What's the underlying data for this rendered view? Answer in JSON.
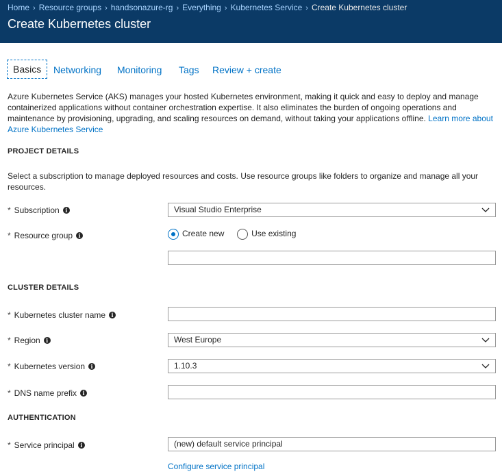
{
  "breadcrumb": [
    "Home",
    "Resource groups",
    "handsonazure-rg",
    "Everything",
    "Kubernetes Service"
  ],
  "breadcrumb_current": "Create Kubernetes cluster",
  "title": "Create Kubernetes cluster",
  "tabs": [
    "Basics",
    "Networking",
    "Monitoring",
    "Tags",
    "Review + create"
  ],
  "active_tab": "Basics",
  "intro": {
    "text": "Azure Kubernetes Service (AKS) manages your hosted Kubernetes environment, making it quick and easy to deploy and manage containerized applications without container orchestration expertise. It also eliminates the burden of ongoing operations and maintenance by provisioning, upgrading, and scaling resources on demand, without taking your applications offline.",
    "link": "Learn more about Azure Kubernetes Service"
  },
  "project": {
    "heading": "PROJECT DETAILS",
    "description": "Select a subscription to manage deployed resources and costs. Use resource groups like folders to organize and manage all your resources.",
    "subscription_label": "Subscription",
    "subscription_value": "Visual Studio Enterprise",
    "resource_group_label": "Resource group",
    "create_new": "Create new",
    "use_existing": "Use existing",
    "resource_group_value": ""
  },
  "cluster": {
    "heading": "CLUSTER DETAILS",
    "name_label": "Kubernetes cluster name",
    "name_value": "",
    "region_label": "Region",
    "region_value": "West Europe",
    "version_label": "Kubernetes version",
    "version_value": "1.10.3",
    "dns_label": "DNS name prefix",
    "dns_value": ""
  },
  "auth": {
    "heading": "AUTHENTICATION",
    "sp_label": "Service principal",
    "sp_value": "(new) default service principal",
    "configure_link": "Configure service principal"
  },
  "required_marker": "*",
  "colors": {
    "header_bg": "#0b3a66",
    "link": "#0072c6"
  }
}
